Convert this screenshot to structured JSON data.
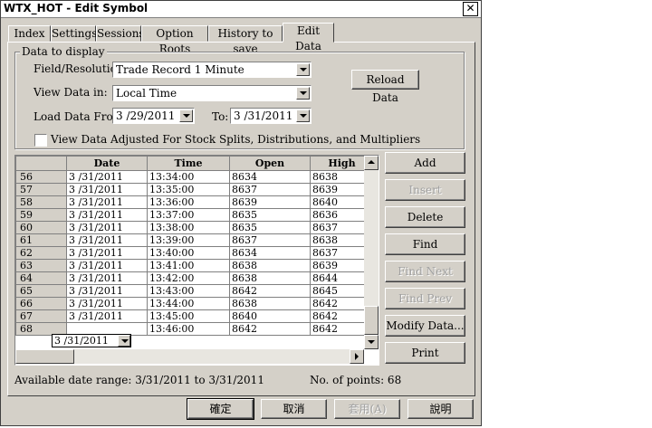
{
  "window": {
    "title": "WTX_HOT - Edit Symbol",
    "close": "✕"
  },
  "tabs": [
    "Index",
    "Settings",
    "Sessions",
    "Option Roots",
    "History to save",
    "Edit Data"
  ],
  "display": {
    "group_label": "Data to display",
    "field_label": "Field/Resolution:",
    "field_value": "Trade Record 1 Minute",
    "view_label": "View Data in:",
    "view_value": "Local Time",
    "from_label": "Load Data From:",
    "from_value": "3 /29/2011",
    "to_label": "To:",
    "to_value": "3 /31/2011",
    "reload": "Reload Data",
    "adjust_label": "View Data Adjusted For Stock Splits, Distributions, and Multipliers"
  },
  "table": {
    "columns": [
      "",
      "Date",
      "Time",
      "Open",
      "High"
    ],
    "rows": [
      [
        "56",
        "3 /31/2011",
        "13:34:00",
        "8634",
        "8638"
      ],
      [
        "57",
        "3 /31/2011",
        "13:35:00",
        "8637",
        "8639"
      ],
      [
        "58",
        "3 /31/2011",
        "13:36:00",
        "8639",
        "8640"
      ],
      [
        "59",
        "3 /31/2011",
        "13:37:00",
        "8635",
        "8636"
      ],
      [
        "60",
        "3 /31/2011",
        "13:38:00",
        "8635",
        "8637"
      ],
      [
        "61",
        "3 /31/2011",
        "13:39:00",
        "8637",
        "8638"
      ],
      [
        "62",
        "3 /31/2011",
        "13:40:00",
        "8634",
        "8637"
      ],
      [
        "63",
        "3 /31/2011",
        "13:41:00",
        "8638",
        "8639"
      ],
      [
        "64",
        "3 /31/2011",
        "13:42:00",
        "8638",
        "8644"
      ],
      [
        "65",
        "3 /31/2011",
        "13:43:00",
        "8642",
        "8645"
      ],
      [
        "66",
        "3 /31/2011",
        "13:44:00",
        "8638",
        "8642"
      ],
      [
        "67",
        "3 /31/2011",
        "13:45:00",
        "8640",
        "8642"
      ],
      [
        "68",
        "",
        "13:46:00",
        "8642",
        "8642"
      ]
    ],
    "editing_cell": "3 /31/2011"
  },
  "side_buttons": {
    "add": "Add",
    "insert": "Insert",
    "delete": "Delete",
    "find": "Find",
    "find_next": "Find Next",
    "find_prev": "Find Prev",
    "modify": "Modify Data...",
    "print": "Print"
  },
  "status": {
    "range": "Available date range: 3/31/2011 to 3/31/2011",
    "points": "No. of points: 68"
  },
  "footer": {
    "ok": "確定",
    "cancel": "取消",
    "apply": "套用(A)",
    "help": "說明"
  }
}
